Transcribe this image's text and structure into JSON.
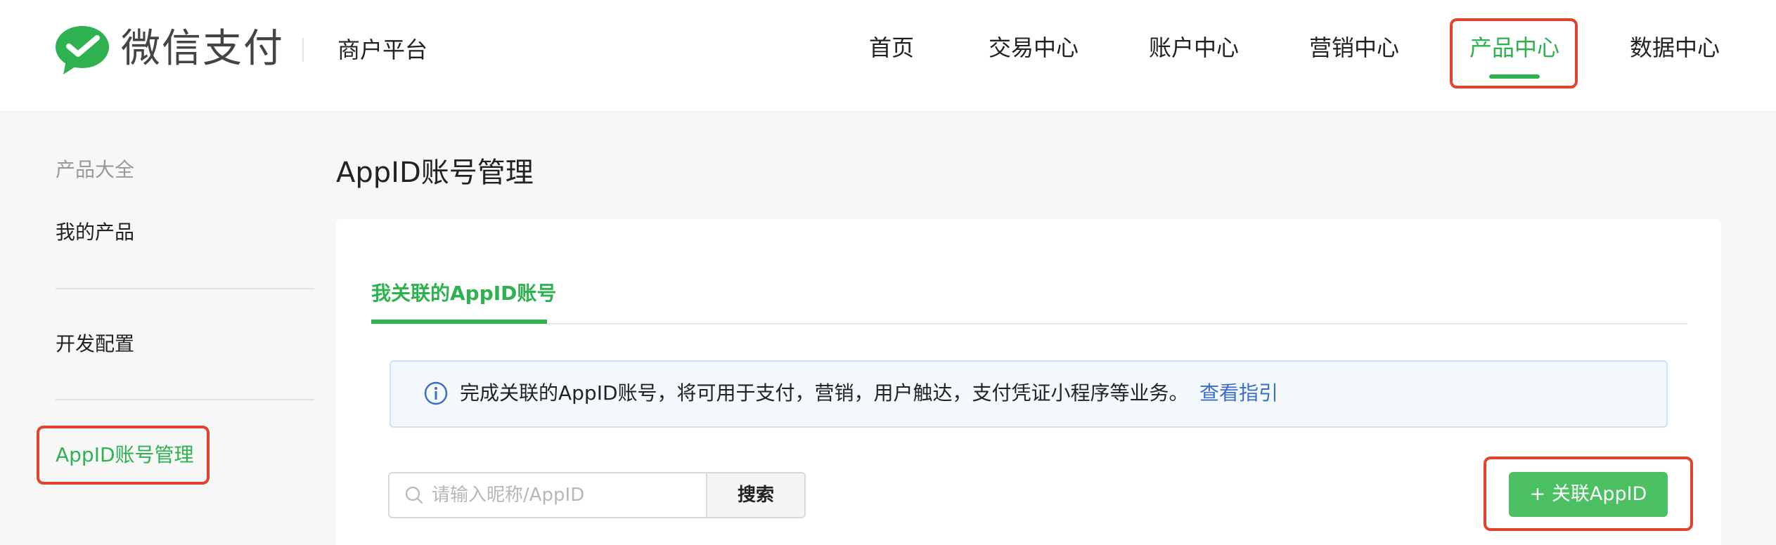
{
  "header": {
    "brand": "微信支付",
    "subbrand": "商户平台",
    "nav": [
      "首页",
      "交易中心",
      "账户中心",
      "营销中心",
      "产品中心",
      "数据中心"
    ],
    "active_nav": "产品中心"
  },
  "sidebar": {
    "section": "产品大全",
    "items": [
      "我的产品",
      "开发配置",
      "AppID账号管理"
    ],
    "active_item": "AppID账号管理"
  },
  "main": {
    "title": "AppID账号管理",
    "tab": "我关联的AppID账号",
    "notice": "完成关联的AppID账号，将可用于支付，营销，用户触达，支付凭证小程序等业务。",
    "notice_link": "查看指引",
    "search_placeholder": "请输入昵称/AppID",
    "search_button": "搜索",
    "add_button": "+ 关联AppID"
  },
  "colors": {
    "accent": "#2db24f",
    "annotation": "#e2432f",
    "link": "#3b6ec9"
  },
  "icons": [
    "wechat-pay-logo",
    "info-icon",
    "search-icon"
  ]
}
